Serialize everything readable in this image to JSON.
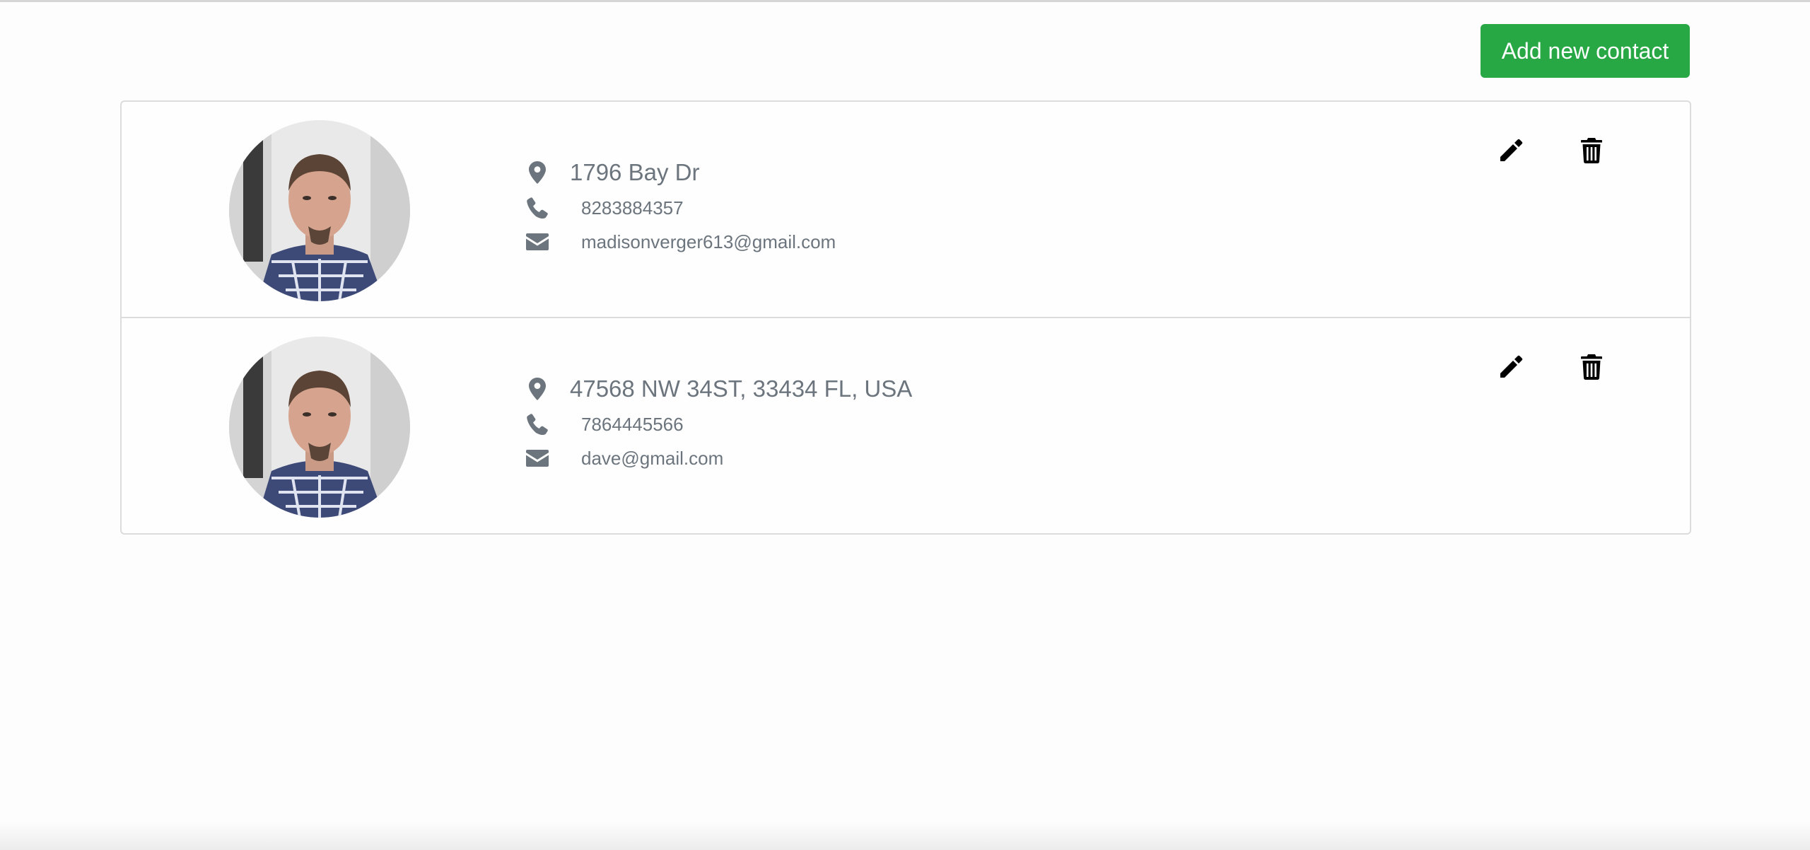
{
  "toolbar": {
    "add_label": "Add new contact",
    "accent_color": "#28a745"
  },
  "contacts": [
    {
      "address": "1796 Bay Dr",
      "phone": "8283884357",
      "email": "madisonverger613@gmail.com"
    },
    {
      "address": "47568 NW 34ST, 33434 FL, USA",
      "phone": "7864445566",
      "email": "dave@gmail.com"
    }
  ],
  "icons": {
    "address": "map-marker-icon",
    "phone": "phone-icon",
    "email": "envelope-icon",
    "edit": "pencil-icon",
    "delete": "trash-icon"
  },
  "colors": {
    "text_muted": "#6c757d",
    "border": "#dcdcdc"
  }
}
